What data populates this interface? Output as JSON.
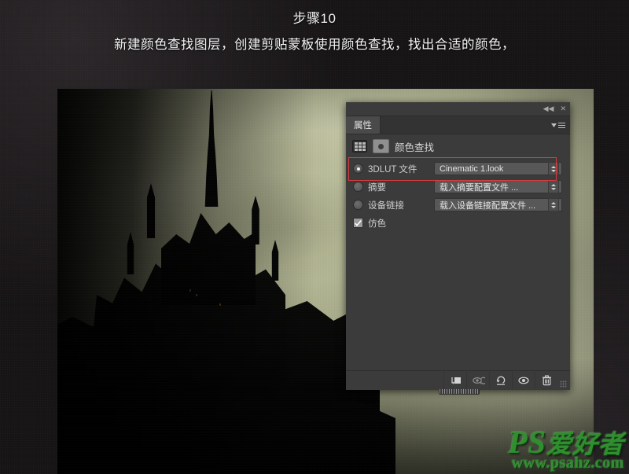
{
  "caption": {
    "step_title": "步骤10",
    "instruction": "新建颜色查找图层，创建剪贴蒙板使用颜色查找，找出合适的颜色，"
  },
  "panel": {
    "titlebar": {
      "collapse_icon": "◀◀",
      "close_icon": "✕"
    },
    "tab_label": "属性",
    "menu_icon": "panel-menu-icon",
    "adjustment": {
      "grid_icon": "grid-icon",
      "circle_icon": "adjustment-circle-icon",
      "title": "颜色查找"
    },
    "rows": [
      {
        "id": "lut-3dlut",
        "control": "radio",
        "selected": true,
        "label": "3DLUT 文件",
        "value": "Cinematic 1.look",
        "highlighted": true
      },
      {
        "id": "lut-abstract",
        "control": "radio",
        "selected": false,
        "label": "摘要",
        "value": "载入摘要配置文件 ...",
        "highlighted": false
      },
      {
        "id": "lut-device-link",
        "control": "radio",
        "selected": false,
        "label": "设备链接",
        "value": "载入设备链接配置文件 ...",
        "highlighted": false
      },
      {
        "id": "dither",
        "control": "checkbox",
        "checked": true,
        "label": "仿色"
      }
    ],
    "footer_buttons": [
      {
        "id": "clip-to-layer",
        "icon": "clip-to-layer-icon"
      },
      {
        "id": "view-previous-state",
        "icon": "eye-arrow-icon"
      },
      {
        "id": "reset-adjustment",
        "icon": "reset-arrow-icon"
      },
      {
        "id": "toggle-visibility",
        "icon": "eye-icon"
      },
      {
        "id": "delete-adjustment",
        "icon": "trash-icon"
      }
    ],
    "highlight_color": "#e0393b"
  },
  "photo": {
    "name": "mont-saint-michel-abbey-dark-photo"
  },
  "watermark": {
    "brand_ps": "PS",
    "brand_cn": "爱好者",
    "url": "www.psahz.com",
    "color": "#2f8f2f"
  }
}
